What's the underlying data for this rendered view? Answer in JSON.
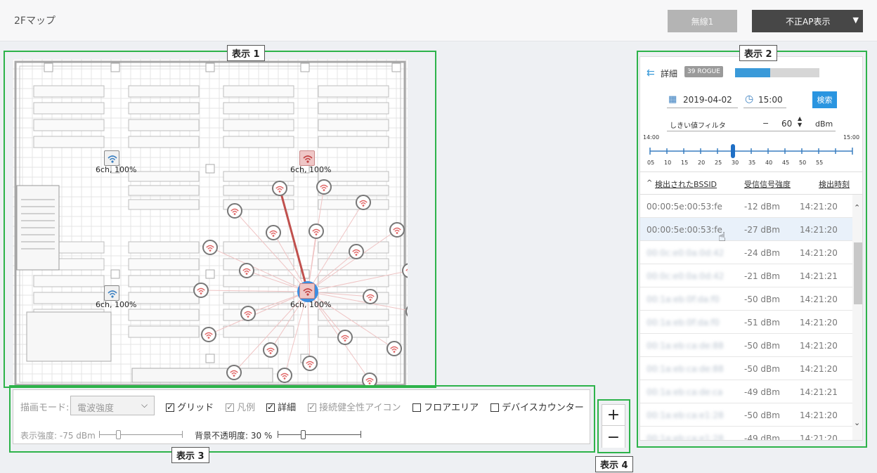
{
  "header": {
    "title": "2Fマップ",
    "wireless_button": "無線1",
    "rogue_button": "不正AP表示",
    "rogue_caret": "▼"
  },
  "callouts": {
    "display1": "表示 1",
    "display2": "表示 2",
    "display3": "表示 3",
    "display4": "表示 4"
  },
  "map": {
    "ap_captions": [
      "6ch, 100%",
      "6ch, 100%",
      "6ch, 100%",
      "6ch, 100%"
    ]
  },
  "detail_panel": {
    "back_label": "詳細",
    "rogue_badge": "39 ROGUE",
    "progress": 0.42,
    "date": "2019-04-02",
    "time": "15:00",
    "search_button": "検索",
    "threshold_label": "しきい値フィルタ",
    "threshold_minus": "−",
    "threshold_value": "60",
    "threshold_unit": "dBm",
    "slider_start": "14:00",
    "slider_end": "15:00",
    "slider_ticks": [
      "05",
      "10",
      "15",
      "20",
      "25",
      "30",
      "35",
      "40",
      "45",
      "50",
      "55"
    ],
    "slider_value": "25",
    "columns": [
      "検出されたBSSID",
      "受信信号強度",
      "検出時刻"
    ],
    "sort_indicator": "^",
    "rows": [
      {
        "bssid": "00:00:5e:00:53:fe",
        "rssi": "-12 dBm",
        "time": "14:21:20",
        "blur": false
      },
      {
        "bssid": "00:00:5e:00:53:fe",
        "rssi": "-27 dBm",
        "time": "14:21:20",
        "blur": false
      },
      {
        "bssid": "00:0c:e0:0a:0d:42",
        "rssi": "-24 dBm",
        "time": "14:21:20",
        "blur": true
      },
      {
        "bssid": "00:0c:e0:0a:0d:42",
        "rssi": "-21 dBm",
        "time": "14:21:21",
        "blur": true
      },
      {
        "bssid": "00:1a:eb:0f:da:f0",
        "rssi": "-50 dBm",
        "time": "14:21:20",
        "blur": true
      },
      {
        "bssid": "00:1a:eb:0f:da:f0",
        "rssi": "-51 dBm",
        "time": "14:21:20",
        "blur": true
      },
      {
        "bssid": "00:1a:eb:ca:de:88",
        "rssi": "-50 dBm",
        "time": "14:21:20",
        "blur": true
      },
      {
        "bssid": "00:1a:eb:ca:de:88",
        "rssi": "-50 dBm",
        "time": "14:21:20",
        "blur": true
      },
      {
        "bssid": "00:1a:eb:ca:de:ca",
        "rssi": "-49 dBm",
        "time": "14:21:21",
        "blur": true
      },
      {
        "bssid": "00:1a:eb:ca:e1:28",
        "rssi": "-50 dBm",
        "time": "14:21:20",
        "blur": true
      },
      {
        "bssid": "00:1a:eb:ca:e1:28",
        "rssi": "-49 dBm",
        "time": "14:21:20",
        "blur": true
      }
    ]
  },
  "controls": {
    "draw_mode_label": "描画モード:",
    "draw_mode_value": "電波強度",
    "grid": "グリッド",
    "legend": "凡例",
    "detail": "詳細",
    "health_icon": "接続健全性アイコン",
    "floor_area": "フロアエリア",
    "device_counter": "デバイスカウンター",
    "strength_label": "表示強度: -75 dBm",
    "opacity_label": "背景不透明度: 30 %"
  },
  "zoom": {
    "in": "+",
    "out": "−"
  },
  "colors": {
    "accent": "#2db34a",
    "primary": "#3a9ad9",
    "rogue": "#e06666",
    "selected": "#3d8ee0"
  }
}
